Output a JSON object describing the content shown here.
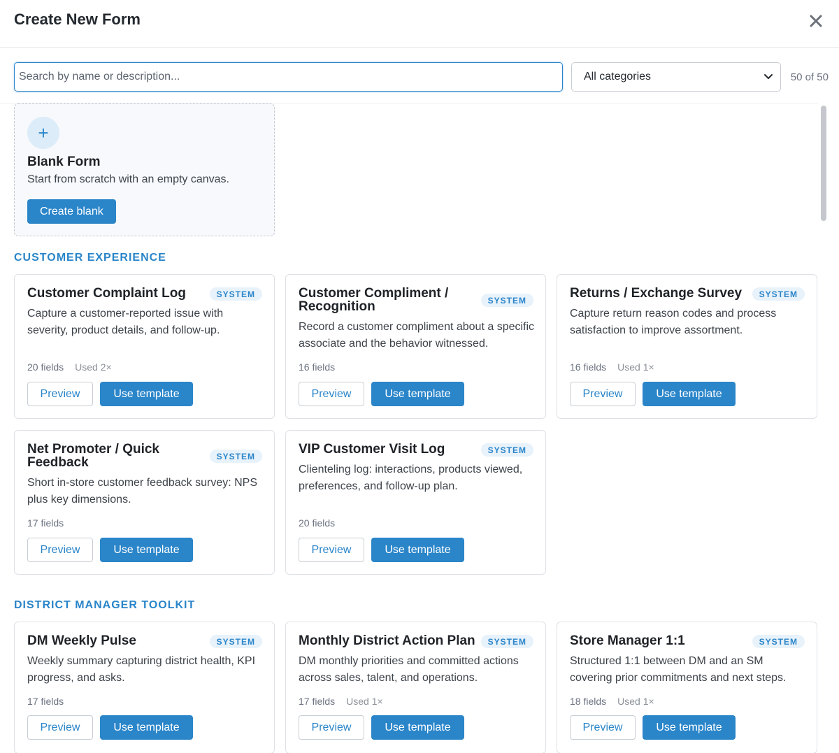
{
  "modal": {
    "title": "Create New Form"
  },
  "search": {
    "placeholder": "Search by name or description...",
    "value": ""
  },
  "filter": {
    "selected": "All categories"
  },
  "result_count": "50 of 50",
  "blank": {
    "title": "Blank Form",
    "description": "Start from scratch with an empty canvas.",
    "button": "Create blank",
    "icon": "plus-icon"
  },
  "buttons": {
    "preview": "Preview",
    "use": "Use template"
  },
  "badge": "SYSTEM",
  "sections": [
    {
      "title": "CUSTOMER EXPERIENCE",
      "templates": [
        {
          "name": "Customer Complaint Log",
          "description": "Capture a customer-reported issue with severity, product details, and follow-up.",
          "fields": "20 fields",
          "used": "Used 2×"
        },
        {
          "name": "Customer Compliment / Recognition",
          "description": "Record a customer compliment about a specific associate and the behavior witnessed.",
          "fields": "16 fields",
          "used": ""
        },
        {
          "name": "Returns / Exchange Survey",
          "description": "Capture return reason codes and process satisfaction to improve assortment.",
          "fields": "16 fields",
          "used": "Used 1×"
        },
        {
          "name": "Net Promoter / Quick Feedback",
          "description": "Short in-store customer feedback survey: NPS plus key dimensions.",
          "fields": "17 fields",
          "used": ""
        },
        {
          "name": "VIP Customer Visit Log",
          "description": "Clienteling log: interactions, products viewed, preferences, and follow-up plan.",
          "fields": "20 fields",
          "used": ""
        }
      ]
    },
    {
      "title": "DISTRICT MANAGER TOOLKIT",
      "templates": [
        {
          "name": "DM Weekly Pulse",
          "description": "Weekly summary capturing district health, KPI progress, and asks.",
          "fields": "17 fields",
          "used": ""
        },
        {
          "name": "Monthly District Action Plan",
          "description": "DM monthly priorities and committed actions across sales, talent, and operations.",
          "fields": "17 fields",
          "used": "Used 1×"
        },
        {
          "name": "Store Manager 1:1",
          "description": "Structured 1:1 between DM and an SM covering prior commitments and next steps.",
          "fields": "18 fields",
          "used": "Used 1×"
        }
      ]
    }
  ]
}
